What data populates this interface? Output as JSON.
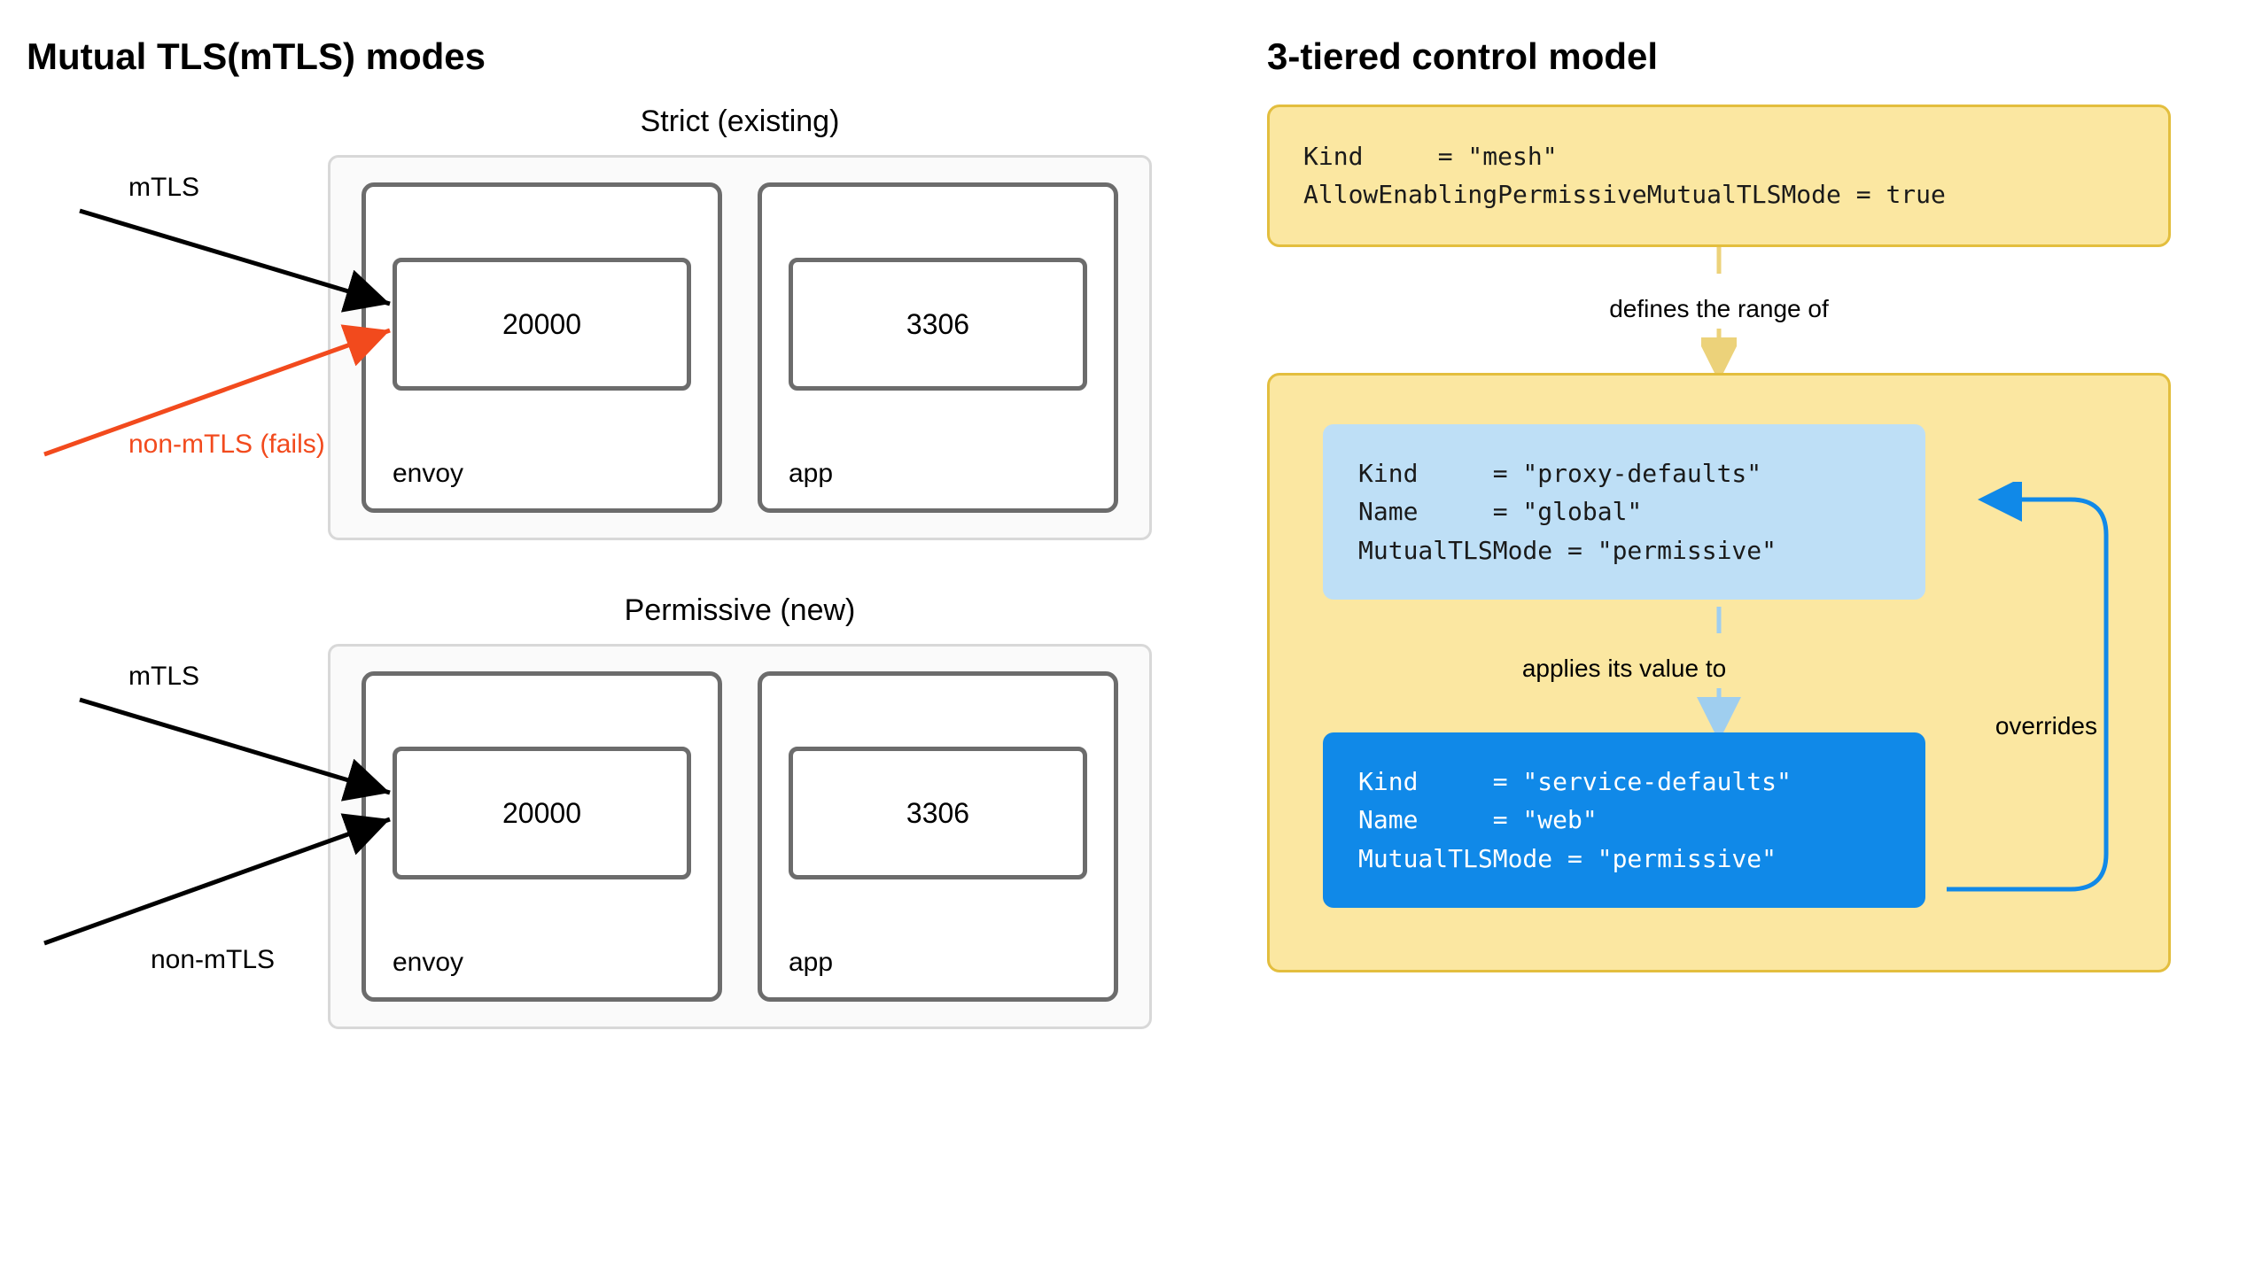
{
  "left": {
    "title": "Mutual TLS(mTLS) modes",
    "modes": [
      {
        "name": "Strict (existing)",
        "envoy_port": "20000",
        "app_port": "3306",
        "envoy_label": "envoy",
        "app_label": "app",
        "arrow1_label": "mTLS",
        "arrow1_color": "#000000",
        "arrow2_label": "non-mTLS\n(fails)",
        "arrow2_color": "#f24a1d"
      },
      {
        "name": "Permissive (new)",
        "envoy_port": "20000",
        "app_port": "3306",
        "envoy_label": "envoy",
        "app_label": "app",
        "arrow1_label": "mTLS",
        "arrow1_color": "#000000",
        "arrow2_label": "non-mTLS",
        "arrow2_color": "#000000"
      }
    ]
  },
  "right": {
    "title": "3-tiered control model",
    "mesh_code": "Kind     = \"mesh\"\nAllowEnablingPermissiveMutualTLSMode = true",
    "flow1": "defines the range of",
    "proxy_code": "Kind     = \"proxy-defaults\"\nName     = \"global\"\nMutualTLSMode = \"permissive\"",
    "flow2": "applies its value to",
    "service_code": "Kind     = \"service-defaults\"\nName     = \"web\"\nMutualTLSMode = \"permissive\"",
    "overrides": "overrides"
  }
}
